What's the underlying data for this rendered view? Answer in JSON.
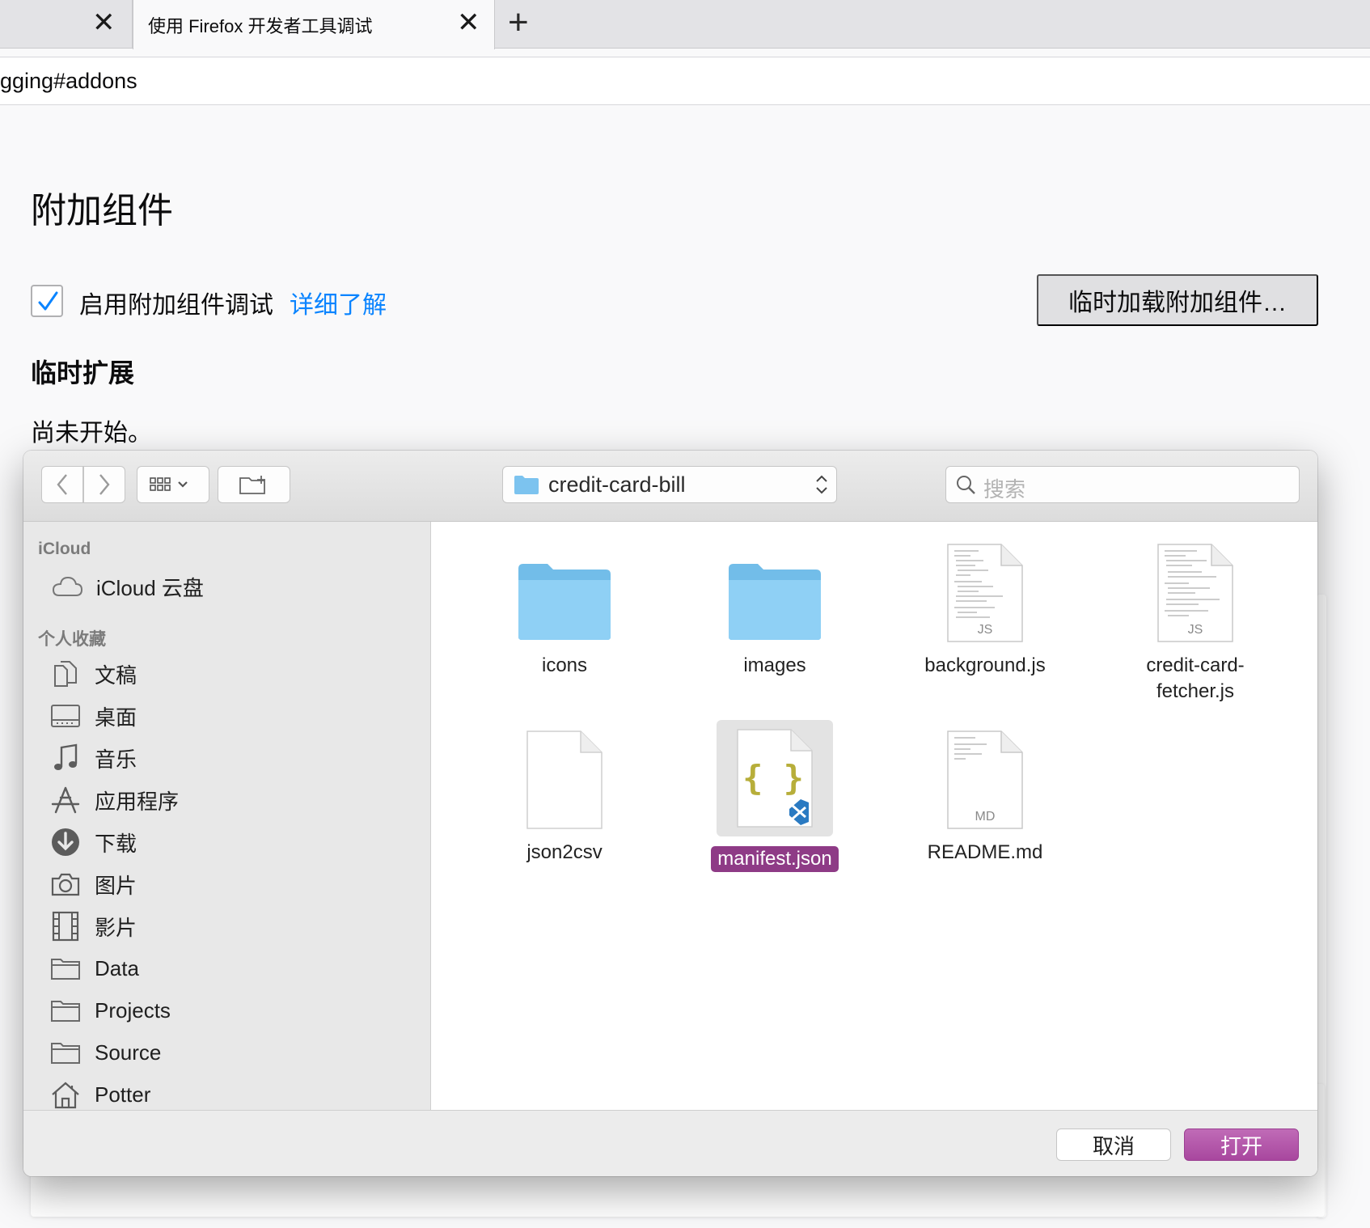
{
  "browser": {
    "prev_tab_close": "✕",
    "active_tab_title": "使用 Firefox 开发者工具调试",
    "active_tab_close": "✕",
    "new_tab": "+",
    "url": "gging#addons"
  },
  "page": {
    "title": "附加组件",
    "enable_debug_label": "启用附加组件调试",
    "learn_more": "详细了解",
    "load_temp_button": "临时加载附加组件…",
    "temp_extensions_heading": "临时扩展",
    "not_started": "尚未开始。"
  },
  "dialog": {
    "current_folder": "credit-card-bill",
    "search_placeholder": "搜索",
    "sidebar": {
      "icloud_heading": "iCloud",
      "icloud_items": [
        {
          "label": "iCloud 云盘",
          "icon": "cloud-icon"
        }
      ],
      "favorites_heading": "个人收藏",
      "favorites": [
        {
          "label": "文稿",
          "icon": "documents-icon"
        },
        {
          "label": "桌面",
          "icon": "desktop-icon"
        },
        {
          "label": "音乐",
          "icon": "music-note-icon"
        },
        {
          "label": "应用程序",
          "icon": "applications-icon"
        },
        {
          "label": "下载",
          "icon": "download-icon"
        },
        {
          "label": "图片",
          "icon": "camera-icon"
        },
        {
          "label": "影片",
          "icon": "film-icon"
        },
        {
          "label": "Data",
          "icon": "folder-icon"
        },
        {
          "label": "Projects",
          "icon": "folder-icon"
        },
        {
          "label": "Source",
          "icon": "folder-icon"
        },
        {
          "label": "Potter",
          "icon": "home-icon"
        }
      ]
    },
    "files": [
      {
        "name": "icons",
        "type": "folder"
      },
      {
        "name": "images",
        "type": "folder"
      },
      {
        "name": "background.js",
        "type": "js",
        "badge": "JS"
      },
      {
        "name": "credit-card-\nfetcher.js",
        "type": "js",
        "badge": "JS"
      },
      {
        "name": "json2csv",
        "type": "blank"
      },
      {
        "name": "manifest.json",
        "type": "json",
        "selected": true,
        "glyph": "{ }"
      },
      {
        "name": "README.md",
        "type": "md",
        "badge": "MD"
      }
    ],
    "cancel_button": "取消",
    "open_button": "打开"
  },
  "colors": {
    "link": "#0a84ff",
    "selection": "#8e3b86",
    "open_button": "#b158a7",
    "folder": "#8ccdf3"
  }
}
